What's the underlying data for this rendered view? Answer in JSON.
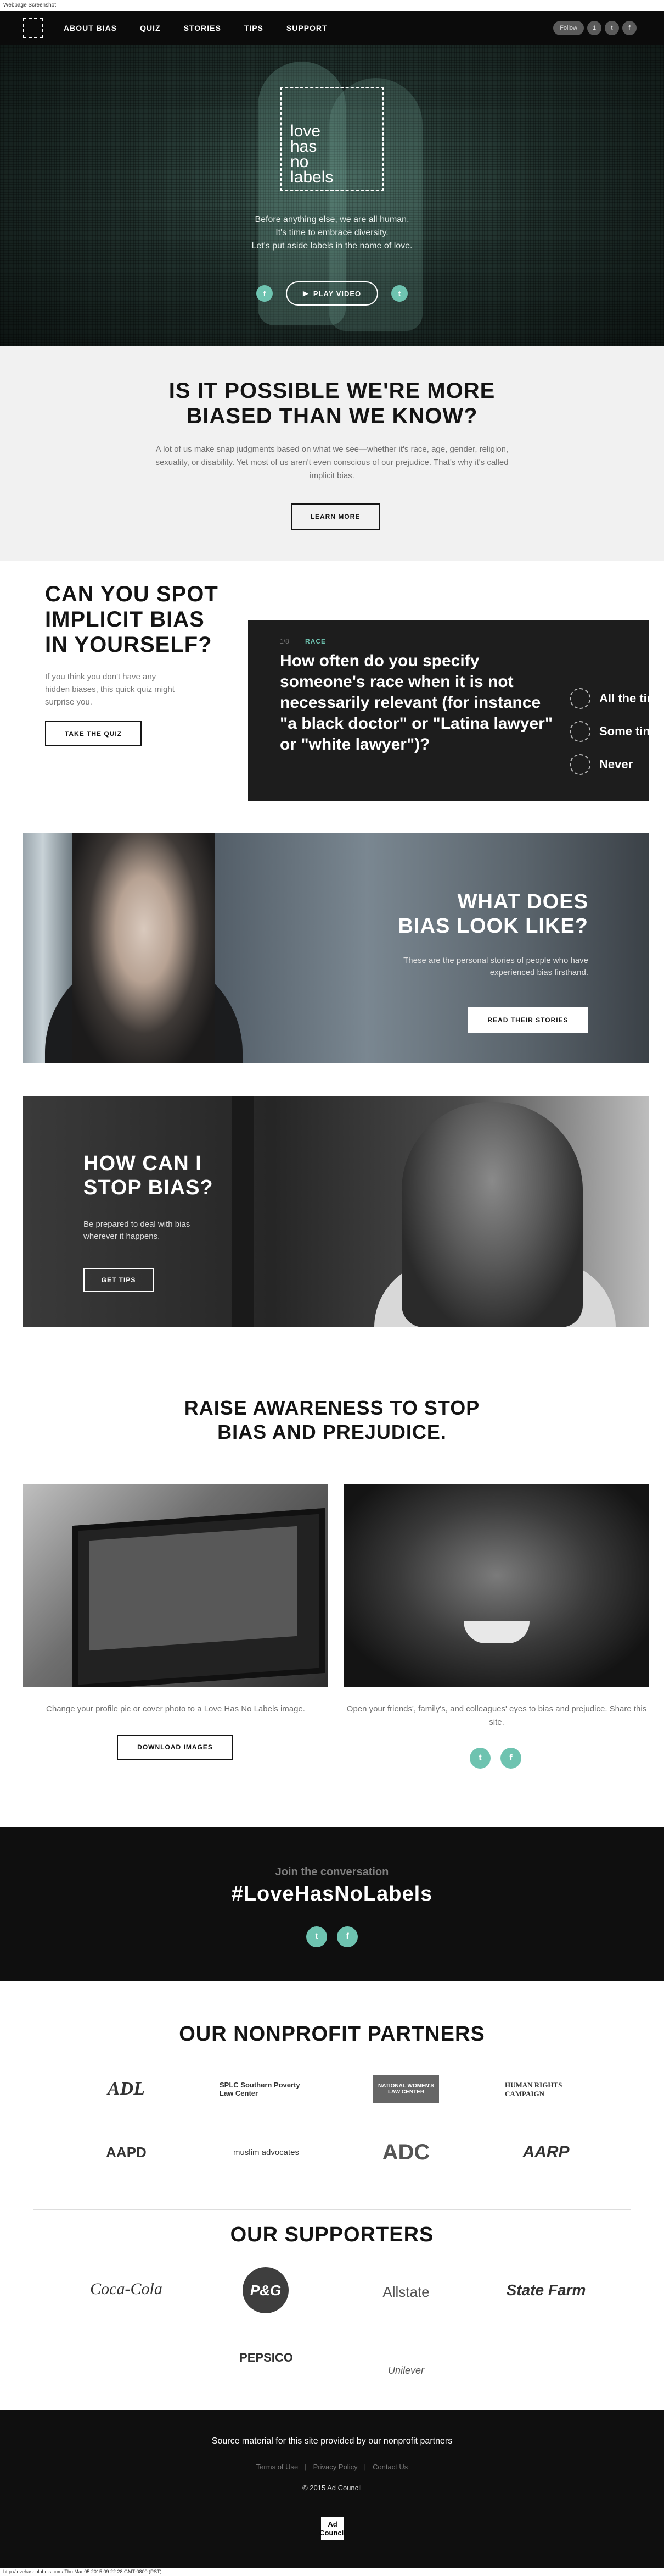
{
  "capture": {
    "header": "Webpage Screenshot",
    "footer": "http://lovehasnolabels.com/ Thu Mar 05 2015 09:22:28 GMT-0800 (PST)"
  },
  "nav": {
    "logo_icon": "dashed-square-logo",
    "links": [
      "ABOUT BIAS",
      "QUIZ",
      "STORIES",
      "TIPS",
      "SUPPORT"
    ],
    "follow": "Follow",
    "follow_count": "1",
    "icons": [
      "twitter-icon",
      "facebook-icon"
    ]
  },
  "hero": {
    "logo_text": "love\nhas\nno\nlabels",
    "lines": [
      "Before anything else, we are all human.",
      "It's time to embrace diversity.",
      "Let's put aside labels in the name of love."
    ],
    "play": "PLAY VIDEO",
    "accent": "#6ec3b0"
  },
  "implicit": {
    "title": "IS IT POSSIBLE WE'RE MORE\nBIASED THAN WE KNOW?",
    "body": "A lot of us make snap judgments based on what we see—whether it's race, age, gender, religion, sexuality, or disability. Yet most of us aren't even conscious of our prejudice. That's why it's called implicit bias.",
    "button": "LEARN MORE"
  },
  "quiz": {
    "title": "CAN YOU SPOT\nIMPLICIT BIAS\nIN YOURSELF?",
    "body": "If you think you don't have any hidden biases, this quick quiz might surprise you.",
    "button": "TAKE THE QUIZ",
    "counter": "1/8",
    "category": "RACE",
    "question": "How often do you specify someone's race when it is not necessarily relevant (for instance \"a black doctor\" or \"Latina lawyer\" or \"white lawyer\")?",
    "options": [
      "All the time",
      "Some time",
      "Never"
    ]
  },
  "look": {
    "title": "WHAT DOES\nBIAS LOOK LIKE?",
    "body": "These are the personal stories of people who have experienced bias firsthand.",
    "button": "READ THEIR STORIES"
  },
  "stop": {
    "title": "HOW CAN I\nSTOP BIAS?",
    "body": "Be prepared to deal with bias wherever it happens.",
    "button": "GET TIPS"
  },
  "raise": {
    "title": "RAISE AWARENESS TO STOP\nBIAS AND PREJUDICE.",
    "left_caption": "Change your profile pic or cover photo to a Love Has No Labels image.",
    "left_button": "DOWNLOAD IMAGES",
    "right_caption": "Open your friends', family's, and colleagues' eyes to bias and prejudice. Share this site."
  },
  "join": {
    "line1": "Join the conversation",
    "hashtag": "#LoveHasNoLabels"
  },
  "partners": {
    "title": "OUR NONPROFIT PARTNERS",
    "logos": [
      "ADL",
      "SPLC Southern Poverty Law Center",
      "NATIONAL WOMEN'S LAW CENTER",
      "HUMAN RIGHTS CAMPAIGN",
      "AAPD",
      "muslim advocates",
      "ADC",
      "AARP"
    ]
  },
  "supporters": {
    "title": "OUR SUPPORTERS",
    "logos": [
      "Coca-Cola",
      "P&G",
      "Allstate",
      "State Farm",
      "PEPSICO",
      "Unilever"
    ]
  },
  "footer": {
    "line": "Source material for this site provided by our nonprofit partners",
    "links": [
      "Terms of Use",
      "Privacy Policy",
      "Contact Us"
    ],
    "copyright": "© 2015 Ad Council",
    "badge": "Ad\nCouncil"
  }
}
